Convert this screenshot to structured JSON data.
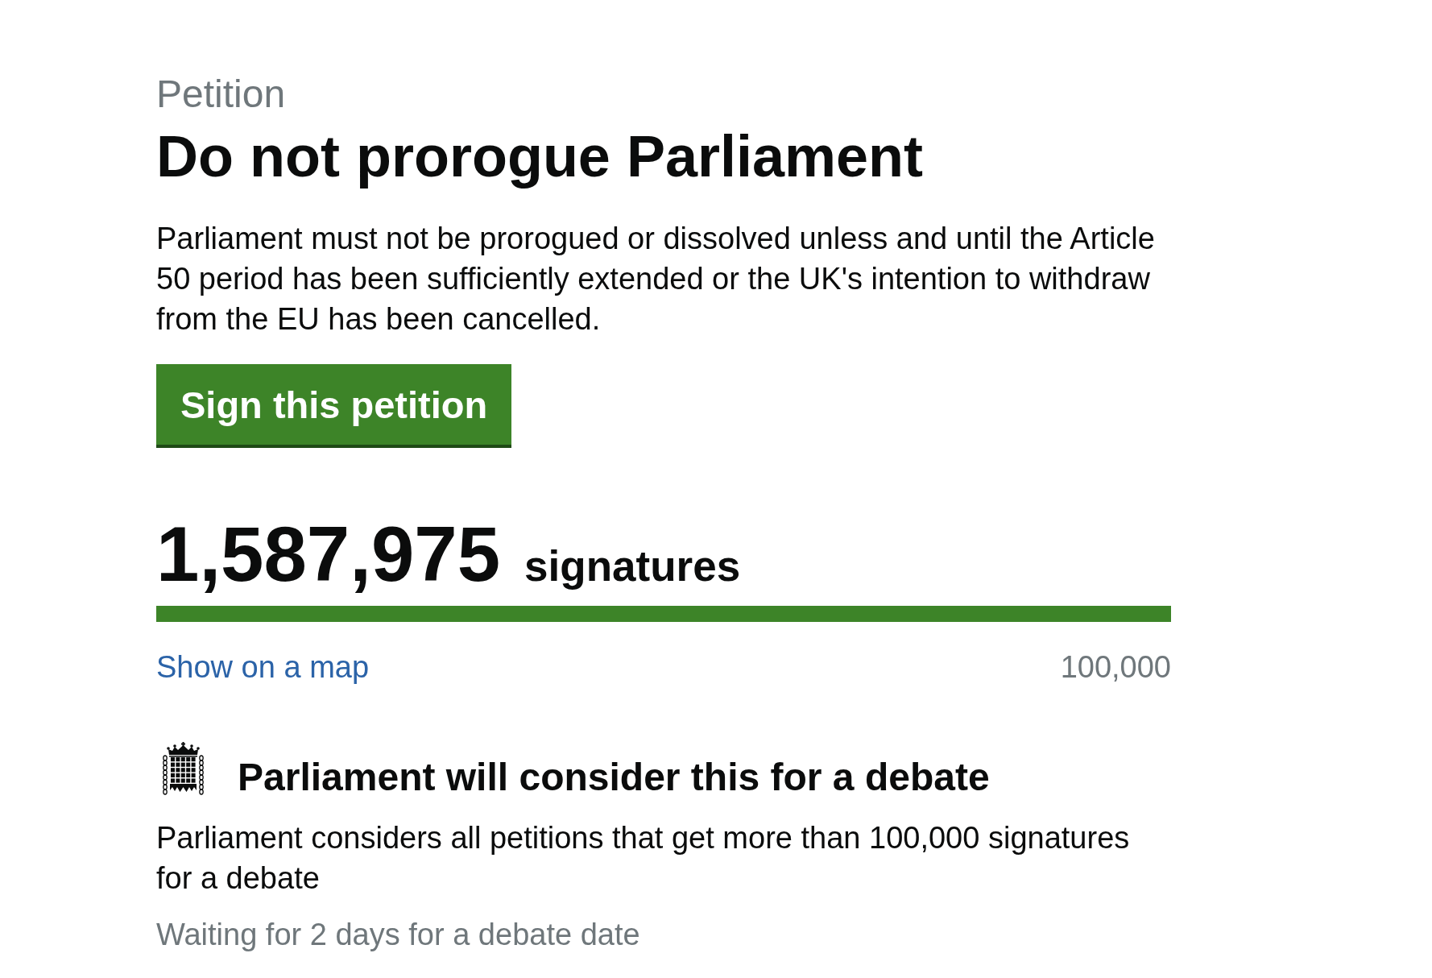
{
  "page_label": "Petition",
  "title": "Do not prorogue Parliament",
  "description": "Parliament must not be prorogued or dissolved unless and until the Article 50 period has been sufficiently extended or the UK's intention to withdraw from the EU has been cancelled.",
  "sign_button": "Sign this petition",
  "signatures": {
    "count": "1,587,975",
    "label": "signatures",
    "level": 1,
    "map_link": "Show on a map",
    "threshold": "100,000"
  },
  "debate": {
    "heading": "Parliament will consider this for a debate",
    "text": "Parliament considers all petitions that get more than 100,000 signatures for a debate",
    "status": "Waiting for 2 days for a debate date"
  }
}
